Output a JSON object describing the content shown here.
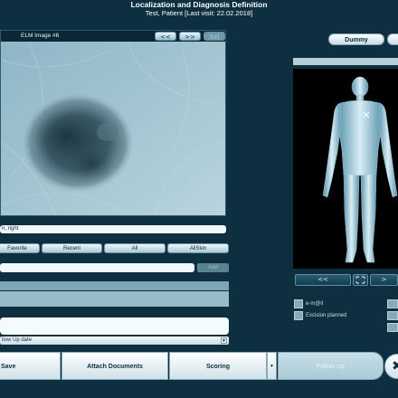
{
  "header": {
    "title": "Localization and Diagnosis Definition",
    "subtitle": "Test, Patient [Last visit: 22.02.2018]"
  },
  "image_panel": {
    "title": "ELM Image #6",
    "prev_label": "<<",
    "next_label": ">>",
    "third_label": "Sel"
  },
  "location": {
    "value": "n, right"
  },
  "tabs": [
    "Favorite",
    "Recent",
    "All",
    "AllSkin"
  ],
  "search": {
    "value": "",
    "add_label": "Add"
  },
  "followup": {
    "selected": "llow Up date"
  },
  "bottom": {
    "save": "Save",
    "attach": "Attach Documents",
    "scoring": "Scoring",
    "follow_up": "Follow Up",
    "more_arrow": "▼"
  },
  "right": {
    "dummy_label": "Dummy",
    "body_prev": "<<",
    "body_next": ">"
  },
  "checkboxes": {
    "email": "e-m@il",
    "excision": "Excision planned"
  }
}
